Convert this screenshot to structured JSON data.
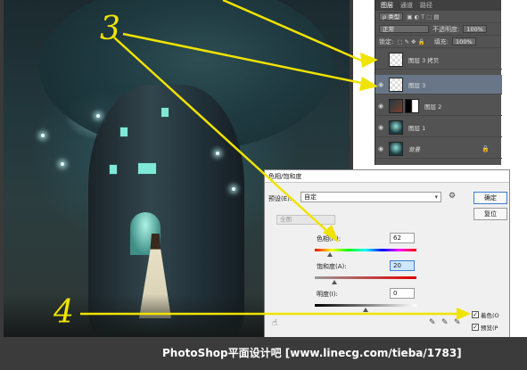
{
  "layers_panel": {
    "tabs": [
      "图层",
      "通道",
      "路径"
    ],
    "filter_label": "ρ 类型",
    "blend_mode": "正常",
    "opacity_label": "不透明度:",
    "opacity_value": "100%",
    "lock_label": "锁定:",
    "fill_label": "填充:",
    "fill_value": "100%",
    "layers": [
      {
        "name": "图层 3 拷贝",
        "visible": false,
        "selected": false
      },
      {
        "name": "图层 3",
        "visible": true,
        "selected": true
      },
      {
        "name": "图层 2",
        "visible": true,
        "selected": false
      },
      {
        "name": "图层 1",
        "visible": true,
        "selected": false
      },
      {
        "name": "背景",
        "visible": true,
        "selected": false
      }
    ]
  },
  "hue_saturation_dialog": {
    "title": "色相/饱和度",
    "preset_label": "预设(E):",
    "preset_value": "自定",
    "ok_label": "确定",
    "reset_label": "复位",
    "channel_value": "全图",
    "hue_label": "色相(H):",
    "hue_value": "62",
    "saturation_label": "饱和度(A):",
    "saturation_value": "20",
    "lightness_label": "明度(I):",
    "lightness_value": "0",
    "colorize_label": "着色(O",
    "colorize_checked": true,
    "preview_label": "预览(P",
    "preview_checked": true
  },
  "annotations": {
    "number_3": "3",
    "number_4": "4",
    "arrow_color": "#f0e300"
  },
  "watermark": {
    "text": "PhotoShop平面设计吧 [www.linecg.com/tieba/1783]"
  }
}
